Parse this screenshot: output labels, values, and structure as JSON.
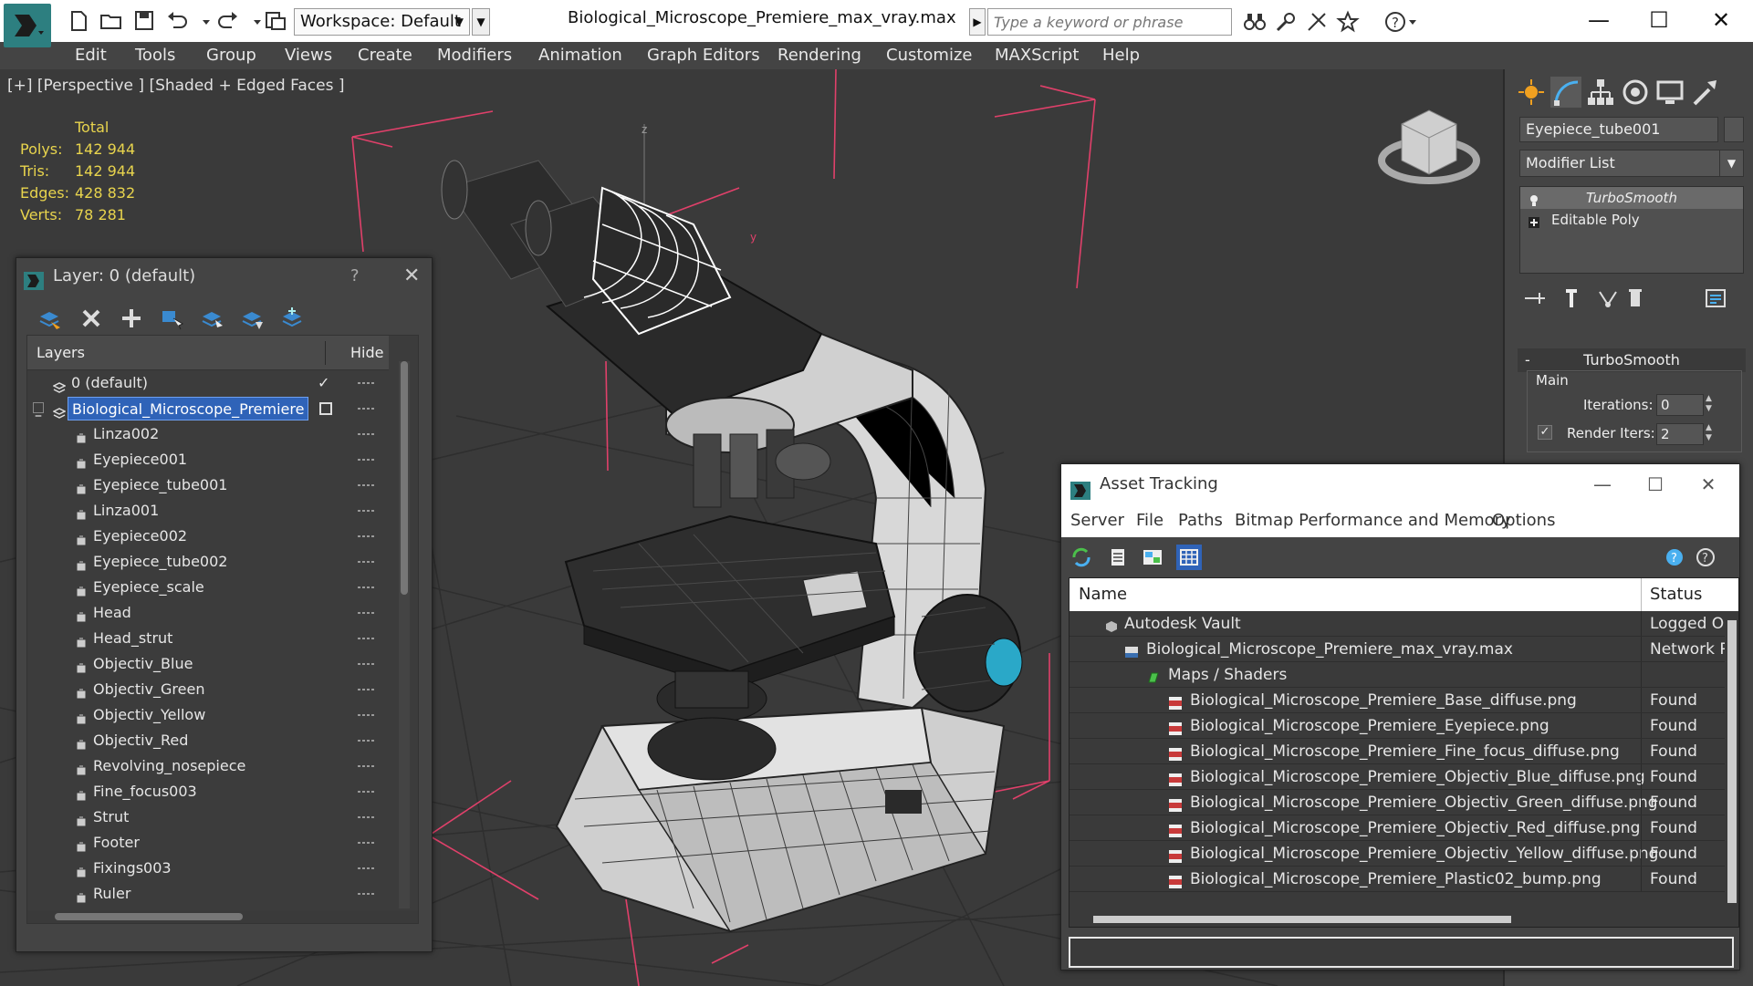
{
  "title_bar": {
    "workspace_label": "Workspace: Default",
    "document_title": "Biological_Microscope_Premiere_max_vray.max",
    "search_placeholder": "Type a keyword or phrase"
  },
  "menu": [
    "Edit",
    "Tools",
    "Group",
    "Views",
    "Create",
    "Modifiers",
    "Animation",
    "Graph Editors",
    "Rendering",
    "Customize",
    "MAXScript",
    "Help"
  ],
  "viewport": {
    "label": "[+] [Perspective ] [Shaded + Edged Faces ]",
    "stats_header": "Total",
    "stats": [
      {
        "label": "Polys:",
        "value": "142 944"
      },
      {
        "label": "Tris:",
        "value": "142 944"
      },
      {
        "label": "Edges:",
        "value": "428 832"
      },
      {
        "label": "Verts:",
        "value": "78 281"
      }
    ],
    "axis_z": "z",
    "axis_y": "y"
  },
  "command_panel": {
    "object_name": "Eyepiece_tube001",
    "modifier_list": "Modifier List",
    "stack": [
      "TurboSmooth",
      "Editable Poly"
    ],
    "rollout_title": "TurboSmooth",
    "rollout_minus": "-",
    "group_label": "Main",
    "iterations_label": "Iterations:",
    "iterations_value": "0",
    "render_iters_label": "Render Iters:",
    "render_iters_value": "2",
    "render_iters_checked": "✓"
  },
  "layer_dialog": {
    "title": "Layer: 0 (default)",
    "help": "?",
    "close": "✕",
    "col_layers": "Layers",
    "col_hide": "Hide",
    "rows": [
      {
        "name": "0 (default)",
        "level": 0
      },
      {
        "name": "Biological_Microscope_Premiere",
        "level": 0
      },
      {
        "name": "Linza002",
        "level": 1
      },
      {
        "name": "Eyepiece001",
        "level": 1
      },
      {
        "name": "Eyepiece_tube001",
        "level": 1
      },
      {
        "name": "Linza001",
        "level": 1
      },
      {
        "name": "Eyepiece002",
        "level": 1
      },
      {
        "name": "Eyepiece_tube002",
        "level": 1
      },
      {
        "name": "Eyepiece_scale",
        "level": 1
      },
      {
        "name": "Head",
        "level": 1
      },
      {
        "name": "Head_strut",
        "level": 1
      },
      {
        "name": "Objectiv_Blue",
        "level": 1
      },
      {
        "name": "Objectiv_Green",
        "level": 1
      },
      {
        "name": "Objectiv_Yellow",
        "level": 1
      },
      {
        "name": "Objectiv_Red",
        "level": 1
      },
      {
        "name": "Revolving_nosepiece",
        "level": 1
      },
      {
        "name": "Fine_focus003",
        "level": 1
      },
      {
        "name": "Strut",
        "level": 1
      },
      {
        "name": "Footer",
        "level": 1
      },
      {
        "name": "Fixings003",
        "level": 1
      },
      {
        "name": "Ruler",
        "level": 1
      }
    ],
    "default_check": "✓"
  },
  "asset_dialog": {
    "title": "Asset Tracking",
    "minimize": "—",
    "maximize": "☐",
    "close": "✕",
    "menu": [
      "Server",
      "File",
      "Paths",
      "Bitmap Performance and Memory",
      "Options"
    ],
    "col_name": "Name",
    "col_status": "Status",
    "rows": [
      {
        "name": "Autodesk Vault",
        "status": "Logged O",
        "level": 0,
        "icon": "vault"
      },
      {
        "name": "Biological_Microscope_Premiere_max_vray.max",
        "status": "Network P",
        "level": 1,
        "icon": "max"
      },
      {
        "name": "Maps / Shaders",
        "status": "",
        "level": 2,
        "icon": "maps"
      },
      {
        "name": "Biological_Microscope_Premiere_Base_diffuse.png",
        "status": "Found",
        "level": 3,
        "icon": "png"
      },
      {
        "name": "Biological_Microscope_Premiere_Eyepiece.png",
        "status": "Found",
        "level": 3,
        "icon": "png"
      },
      {
        "name": "Biological_Microscope_Premiere_Fine_focus_diffuse.png",
        "status": "Found",
        "level": 3,
        "icon": "png"
      },
      {
        "name": "Biological_Microscope_Premiere_Objectiv_Blue_diffuse.png",
        "status": "Found",
        "level": 3,
        "icon": "png"
      },
      {
        "name": "Biological_Microscope_Premiere_Objectiv_Green_diffuse.png",
        "status": "Found",
        "level": 3,
        "icon": "png"
      },
      {
        "name": "Biological_Microscope_Premiere_Objectiv_Red_diffuse.png",
        "status": "Found",
        "level": 3,
        "icon": "png"
      },
      {
        "name": "Biological_Microscope_Premiere_Objectiv_Yellow_diffuse.png",
        "status": "Found",
        "level": 3,
        "icon": "png"
      },
      {
        "name": "Biological_Microscope_Premiere_Plastic02_bump.png",
        "status": "Found",
        "level": 3,
        "icon": "png"
      }
    ]
  },
  "colors": {
    "accent_blue": "#2f63b8",
    "stats_yellow": "#e8d44d",
    "app_teal": "#2d7f80",
    "gizmo_pink": "#e0406a",
    "knob_cyan": "#2aa8c8"
  }
}
